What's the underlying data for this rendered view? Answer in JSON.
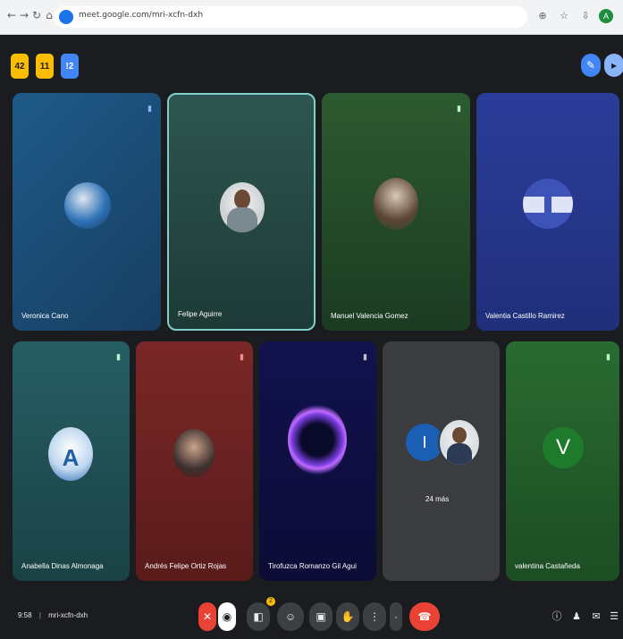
{
  "browser": {
    "url": "meet.google.com/mri-xcfn-dxh",
    "nav_icons": [
      "back-icon",
      "forward-icon",
      "reload-icon",
      "home-icon"
    ],
    "tool_icons": [
      "zoom-icon",
      "bookmark-icon",
      "download-icon"
    ],
    "profile_initial": "A"
  },
  "top_chips": [
    {
      "label": "42"
    },
    {
      "label": "11"
    },
    {
      "label": "!2"
    }
  ],
  "top_right": [
    "info-icon",
    "chat-icon"
  ],
  "tiles_row1": [
    {
      "name": "Veronica Cano",
      "bg": "#1b4d78",
      "kind": "photo"
    },
    {
      "name": "Felipe Aguirre",
      "bg": "#24433f",
      "kind": "photo",
      "active": true
    },
    {
      "name": "Manuel Valencia Gomez",
      "bg": "#1f4f2e",
      "kind": "photo"
    },
    {
      "name": "Valentia Castillo Ramirez",
      "bg": "#2a3a8c",
      "kind": "logo"
    }
  ],
  "tiles_row2": [
    {
      "name": "Anabella Dinas Almonaga",
      "bg": "#1f4f55",
      "kind": "photo"
    },
    {
      "name": "Andrés Felipe Ortiz Rojas",
      "bg": "#6a2222",
      "kind": "photo"
    },
    {
      "name": "Tirofuzca Romanzo Gil Agui",
      "bg": "#11114a",
      "kind": "orb"
    },
    {
      "name": "24 más",
      "bg": "#3a3c40",
      "kind": "group",
      "initial": "I"
    },
    {
      "name": "valentina Castañeda",
      "bg": "#1e5a2a",
      "kind": "initial",
      "initial": "V"
    }
  ],
  "meeting": {
    "time": "9:58",
    "code": "mri-xcfn-dxh",
    "badge": "2"
  },
  "colors": {
    "meet_bg": "#1b1c1f",
    "end_call": "#ea4335",
    "accent": "#4285f4"
  }
}
